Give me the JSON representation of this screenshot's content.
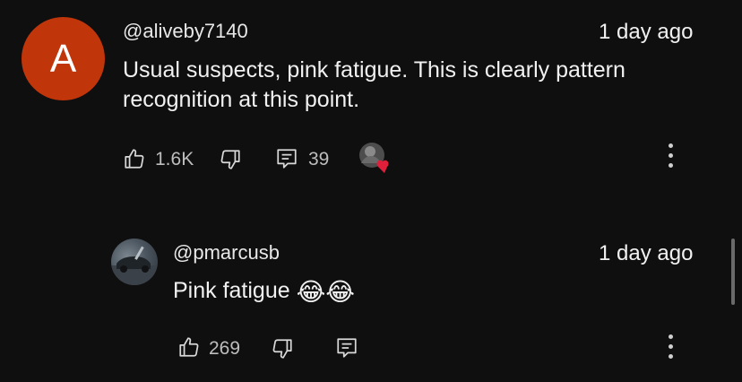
{
  "comment": {
    "avatar_letter": "A",
    "author": "@aliveby7140",
    "time": "1 day ago",
    "text": "Usual suspects, pink fatigue. This is clearly pattern recognition at this point.",
    "likes": "1.6K",
    "replies": "39"
  },
  "reply": {
    "author": "@pmarcusb",
    "time": "1 day ago",
    "text": "Pink fatigue",
    "emoji": "😂😂",
    "likes": "269"
  },
  "colors": {
    "background": "#0f0f0f",
    "avatar_a": "#c1350b",
    "heart": "#e0203a"
  },
  "icons": [
    "like-icon",
    "dislike-icon",
    "reply-icon",
    "more-icon",
    "creator-heart-icon"
  ]
}
